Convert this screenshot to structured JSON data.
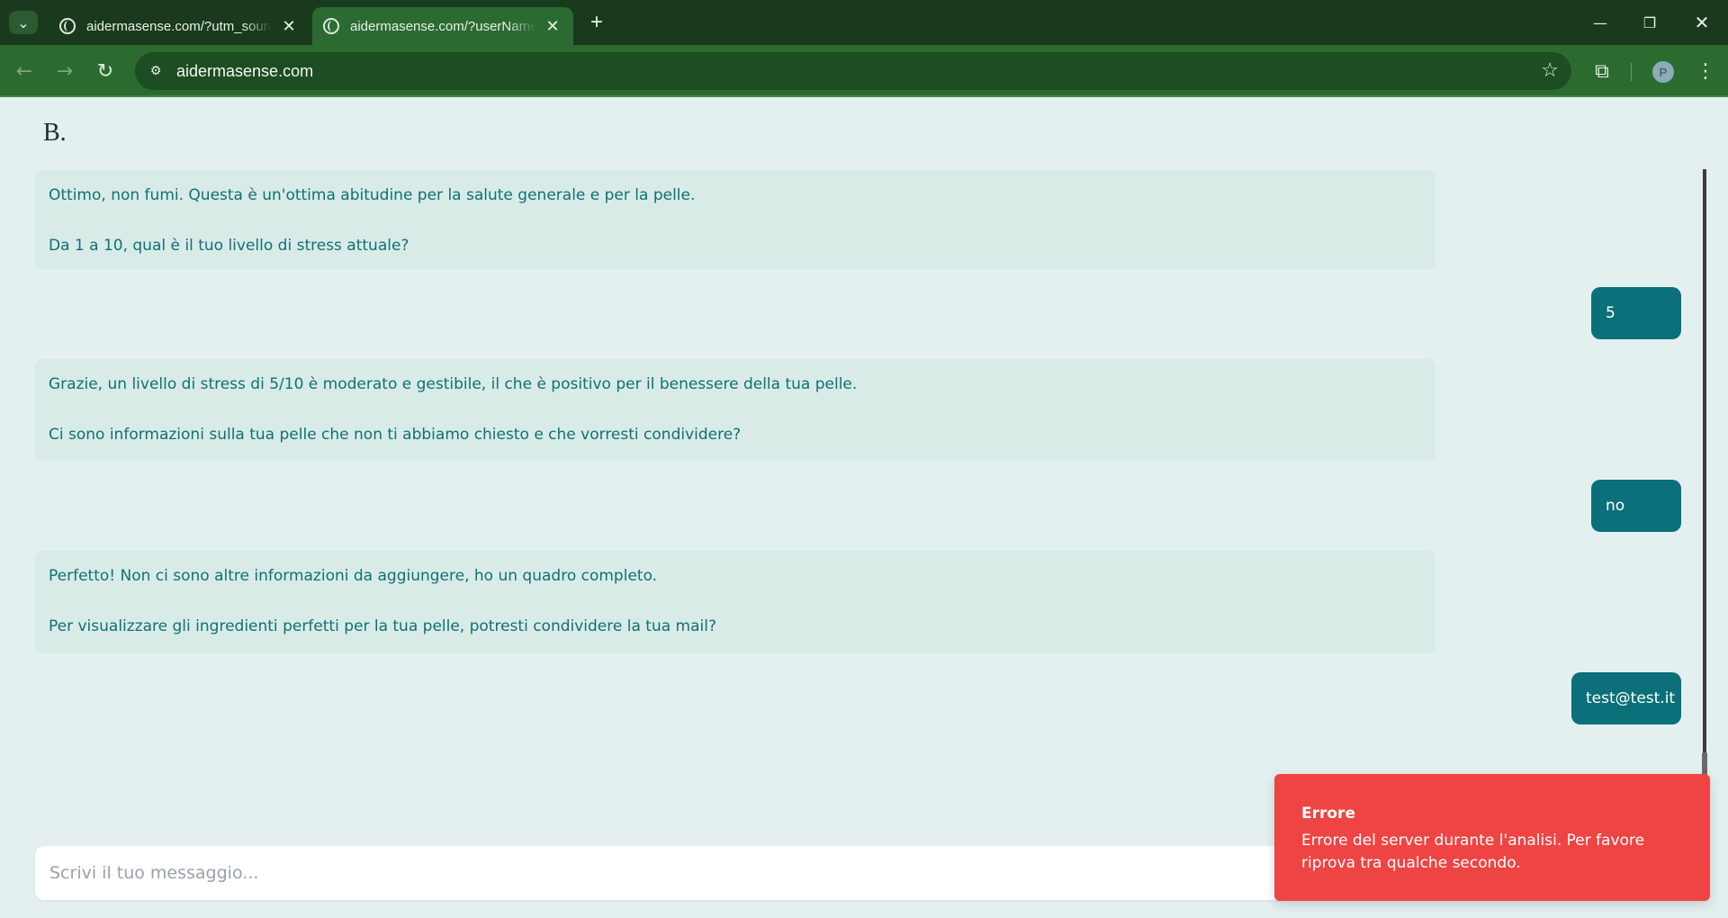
{
  "browser": {
    "tabs": [
      {
        "title": "aidermasense.com/?utm_source",
        "active": false
      },
      {
        "title": "aidermasense.com/?userName=",
        "active": true
      }
    ],
    "url": "aidermasense.com",
    "profile_initial": "P"
  },
  "page": {
    "brand": "B."
  },
  "messages": [
    {
      "role": "bot",
      "lines": [
        "Ottimo, non fumi. Questa è un'ottima abitudine per la salute generale e per la pelle.",
        "Da 1 a 10, qual è il tuo livello di stress attuale?"
      ]
    },
    {
      "role": "user",
      "text": "5"
    },
    {
      "role": "bot",
      "lines": [
        "Grazie, un livello di stress di 5/10 è moderato e gestibile, il che è positivo per il benessere della tua pelle.",
        "Ci sono informazioni sulla tua pelle che non ti abbiamo chiesto e che vorresti condividere?"
      ]
    },
    {
      "role": "user",
      "text": "no"
    },
    {
      "role": "bot",
      "lines": [
        "Perfetto! Non ci sono altre informazioni da aggiungere, ho un quadro completo.",
        "Per visualizzare gli ingredienti perfetti per la tua pelle, potresti condividere la tua mail?"
      ]
    },
    {
      "role": "user",
      "text": "test@test.it"
    }
  ],
  "composer": {
    "placeholder": "Scrivi il tuo messaggio..."
  },
  "toast": {
    "title": "Errore",
    "body": "Errore del server durante l'analisi. Per favore riprova tra qualche secondo."
  },
  "colors": {
    "page_bg": "#e4f0ef",
    "bot_bubble": "#d9ebe6",
    "bot_text": "#0f7077",
    "user_bubble": "#0b7079",
    "toast_bg": "#ef4444",
    "chrome_tabbar": "#193a1d",
    "chrome_toolbar": "#2c6b30"
  }
}
